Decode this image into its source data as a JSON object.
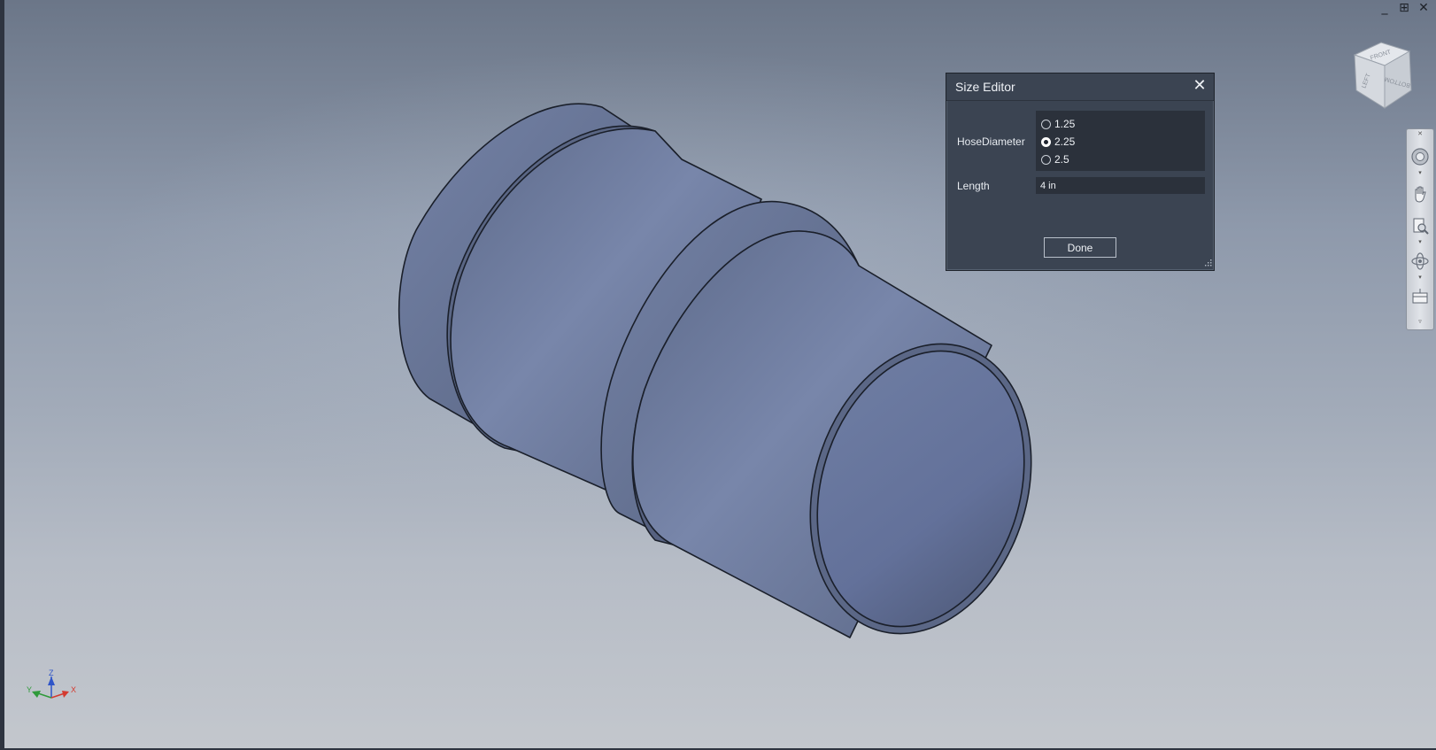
{
  "window_controls": {
    "minimize_glyph": "_",
    "restore_glyph": "⊞",
    "close_glyph": "✕"
  },
  "viewport": {
    "background_top": "#6b7688",
    "background_bottom": "#c3c7cd",
    "model_color": "#7584a6"
  },
  "view_cube": {
    "faces": [
      "FRONT",
      "LEFT",
      "BOTTOM"
    ]
  },
  "size_editor": {
    "title": "Size Editor",
    "close_glyph": "✕",
    "hose_diameter_label": "HoseDiameter",
    "hose_diameter_options": [
      "1.25",
      "2.25",
      "2.5"
    ],
    "hose_diameter_selected": "2.25",
    "length_label": "Length",
    "length_value": "4 in",
    "done_label": "Done"
  },
  "triad": {
    "x_label": "X",
    "y_label": "Y",
    "z_label": "Z",
    "x_color": "#d43a2f",
    "y_color": "#2f9a3a",
    "z_color": "#2f55c8"
  },
  "nav_bar": {
    "items": [
      "steering-wheel",
      "pan",
      "zoom",
      "orbit",
      "look-at"
    ]
  }
}
